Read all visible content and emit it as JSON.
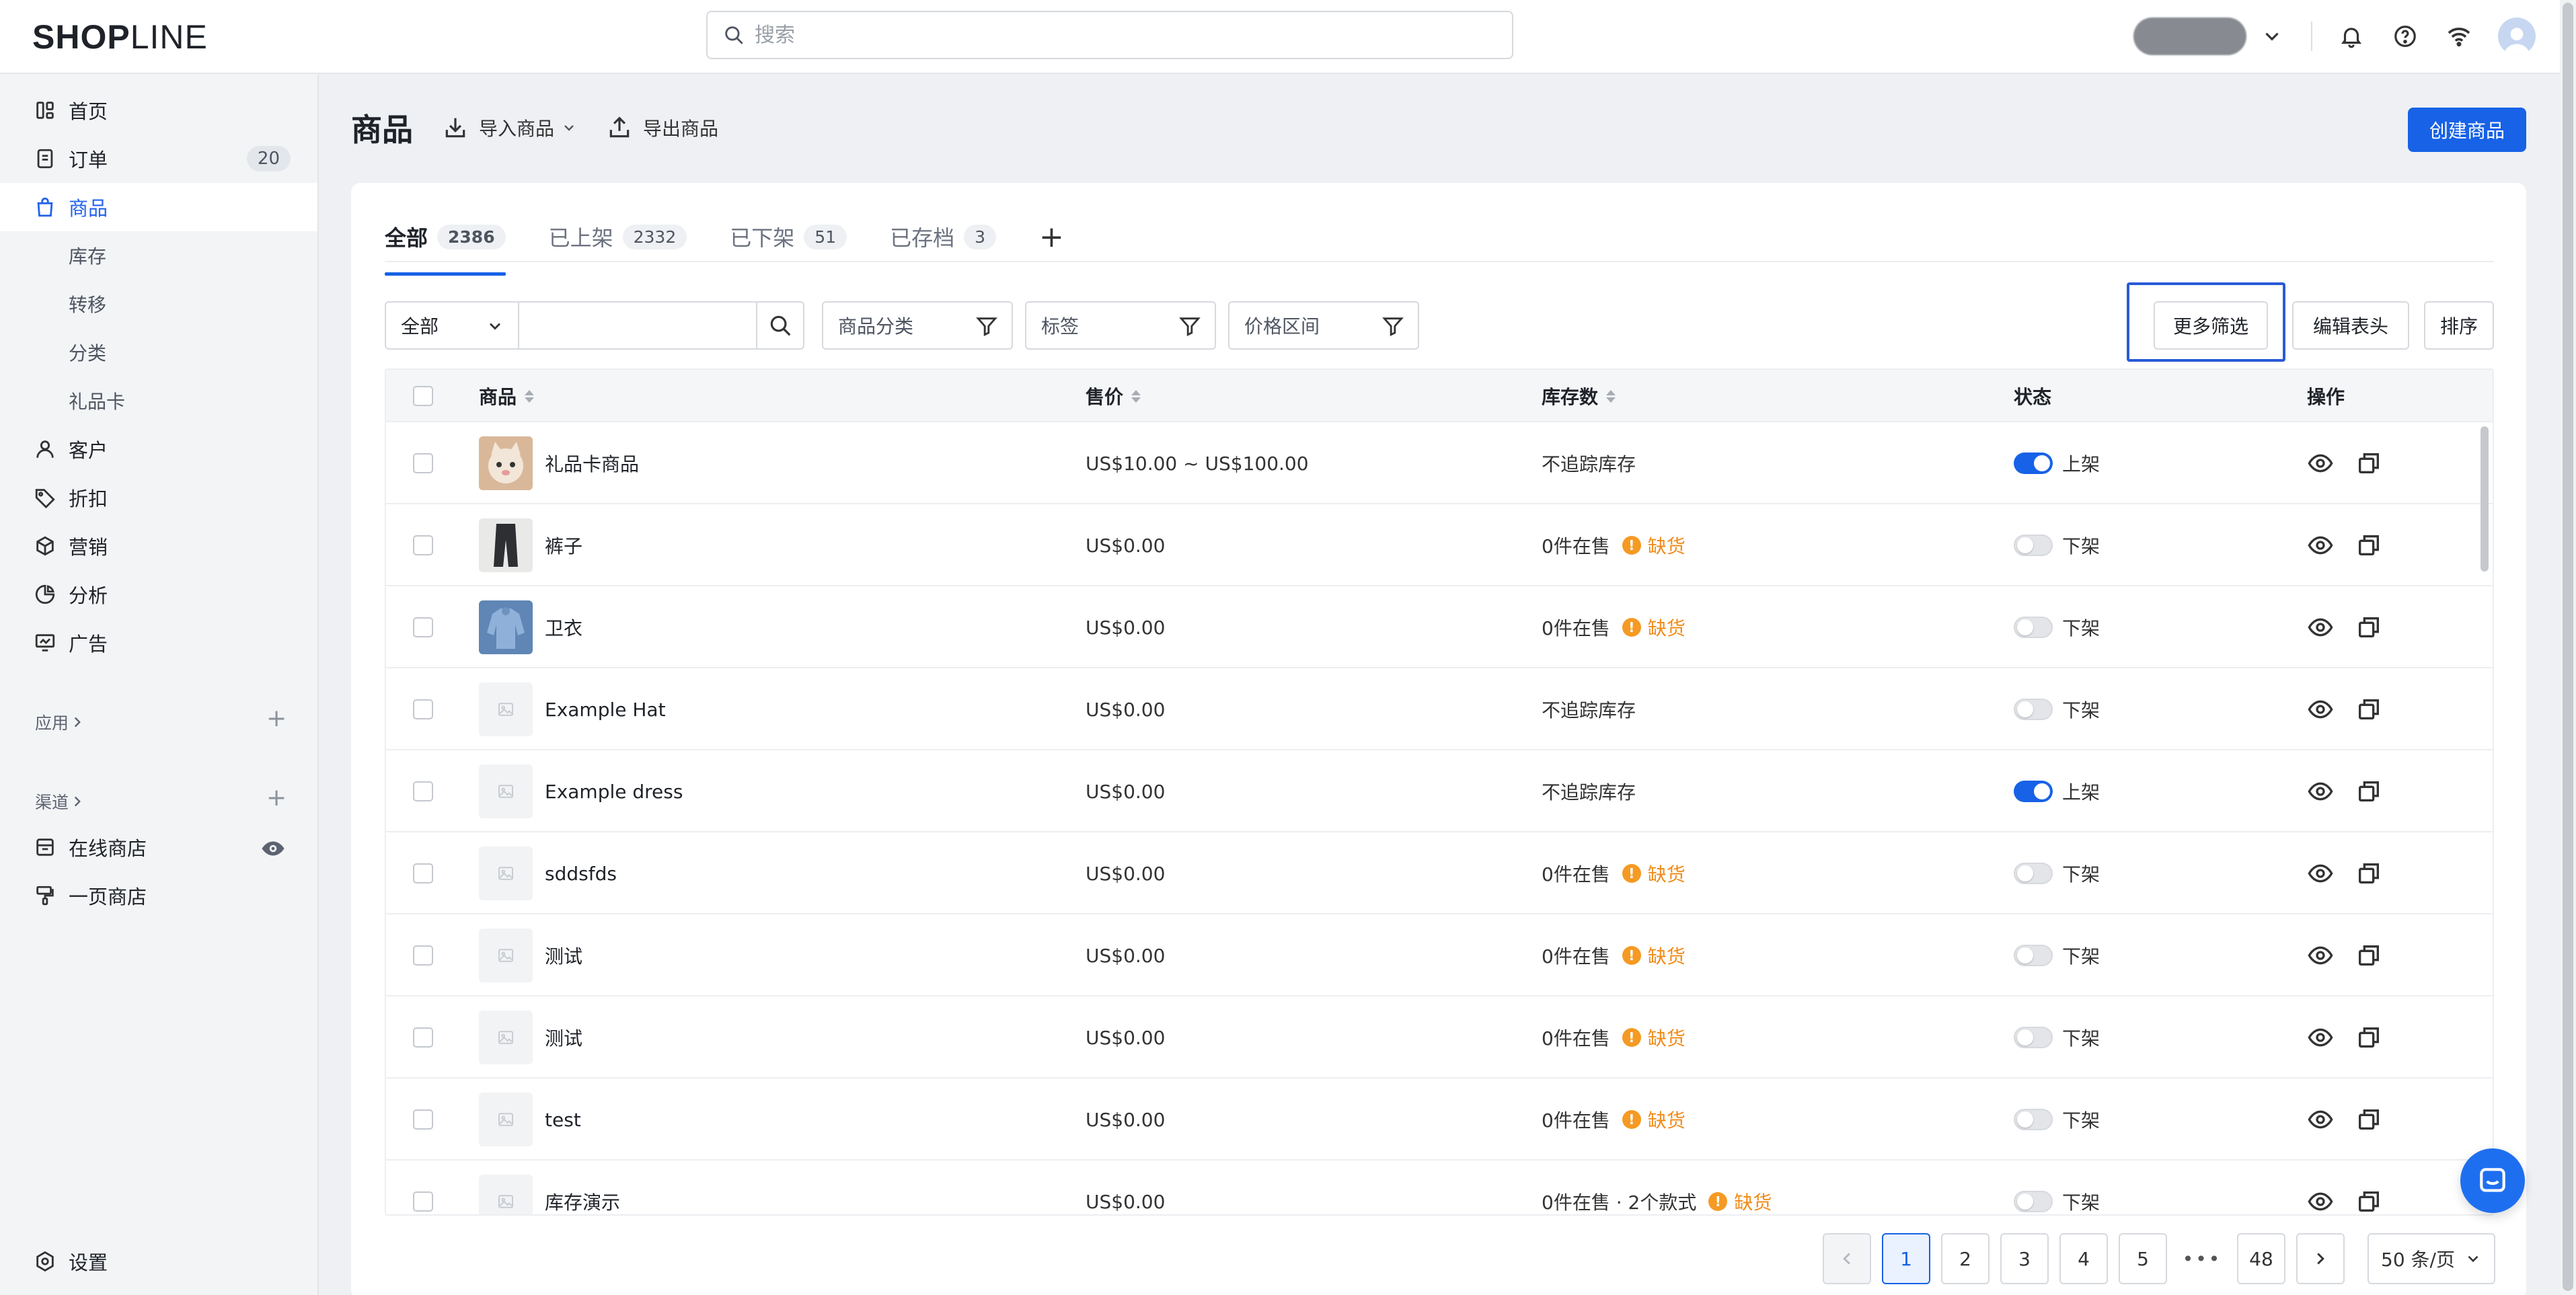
{
  "app": {
    "logo_bold": "SHOP",
    "logo_light": "LINE",
    "search_placeholder": "搜索"
  },
  "sidebar": {
    "items": [
      {
        "label": "首页",
        "icon": "dashboard-icon"
      },
      {
        "label": "订单",
        "icon": "order-icon",
        "badge": "20"
      },
      {
        "label": "商品",
        "icon": "bag-icon",
        "active": true
      },
      {
        "label": "客户",
        "icon": "user-icon"
      },
      {
        "label": "折扣",
        "icon": "tag-icon"
      },
      {
        "label": "营销",
        "icon": "box-icon"
      },
      {
        "label": "分析",
        "icon": "pie-icon"
      },
      {
        "label": "广告",
        "icon": "ad-icon"
      }
    ],
    "sub_items": [
      "库存",
      "转移",
      "分类",
      "礼品卡"
    ],
    "apps_label": "应用",
    "channels_label": "渠道",
    "channels": [
      {
        "label": "在线商店",
        "icon": "store-icon"
      },
      {
        "label": "一页商店",
        "icon": "brush-icon"
      }
    ],
    "settings_label": "设置"
  },
  "header": {
    "title": "商品",
    "import_label": "导入商品",
    "export_label": "导出商品",
    "create_label": "创建商品"
  },
  "tabs": [
    {
      "label": "全部",
      "count": "2386",
      "active": true
    },
    {
      "label": "已上架",
      "count": "2332"
    },
    {
      "label": "已下架",
      "count": "51"
    },
    {
      "label": "已存档",
      "count": "3"
    }
  ],
  "filters": {
    "scope": "全部",
    "search_value": "",
    "category": "商品分类",
    "tags": "标签",
    "price_range": "价格区间",
    "more_filters": "更多筛选",
    "edit_columns": "编辑表头",
    "sort": "排序"
  },
  "table": {
    "columns": [
      "商品",
      "售价",
      "库存数",
      "状态",
      "操作"
    ],
    "rows": [
      {
        "name": "礼品卡商品",
        "price": "US$10.00 ~ US$100.00",
        "stock": "不追踪库存",
        "warn": "",
        "status": "上架",
        "on": true,
        "img": "cat"
      },
      {
        "name": "裤子",
        "price": "US$0.00",
        "stock": "0件在售",
        "warn": "缺货",
        "status": "下架",
        "on": false,
        "img": "pants"
      },
      {
        "name": "卫衣",
        "price": "US$0.00",
        "stock": "0件在售",
        "warn": "缺货",
        "status": "下架",
        "on": false,
        "img": "hoodie"
      },
      {
        "name": "Example Hat",
        "price": "US$0.00",
        "stock": "不追踪库存",
        "warn": "",
        "status": "下架",
        "on": false,
        "img": "placeholder"
      },
      {
        "name": "Example dress",
        "price": "US$0.00",
        "stock": "不追踪库存",
        "warn": "",
        "status": "上架",
        "on": true,
        "img": "placeholder"
      },
      {
        "name": "sddsfds",
        "price": "US$0.00",
        "stock": "0件在售",
        "warn": "缺货",
        "status": "下架",
        "on": false,
        "img": "placeholder"
      },
      {
        "name": "测试",
        "price": "US$0.00",
        "stock": "0件在售",
        "warn": "缺货",
        "status": "下架",
        "on": false,
        "img": "placeholder"
      },
      {
        "name": "测试",
        "price": "US$0.00",
        "stock": "0件在售",
        "warn": "缺货",
        "status": "下架",
        "on": false,
        "img": "placeholder"
      },
      {
        "name": "test",
        "price": "US$0.00",
        "stock": "0件在售",
        "warn": "缺货",
        "status": "下架",
        "on": false,
        "img": "placeholder"
      },
      {
        "name": "库存演示",
        "price": "US$0.00",
        "stock": "0件在售 · 2个款式",
        "warn": "缺货",
        "status": "下架",
        "on": false,
        "img": "placeholder"
      }
    ]
  },
  "pagination": {
    "pages": [
      "1",
      "2",
      "3",
      "4",
      "5"
    ],
    "current": "1",
    "ellipsis": "•••",
    "last": "48",
    "page_size": "50 条/页"
  },
  "colors": {
    "accent": "#1762e6",
    "warning": "#f08c1a"
  }
}
